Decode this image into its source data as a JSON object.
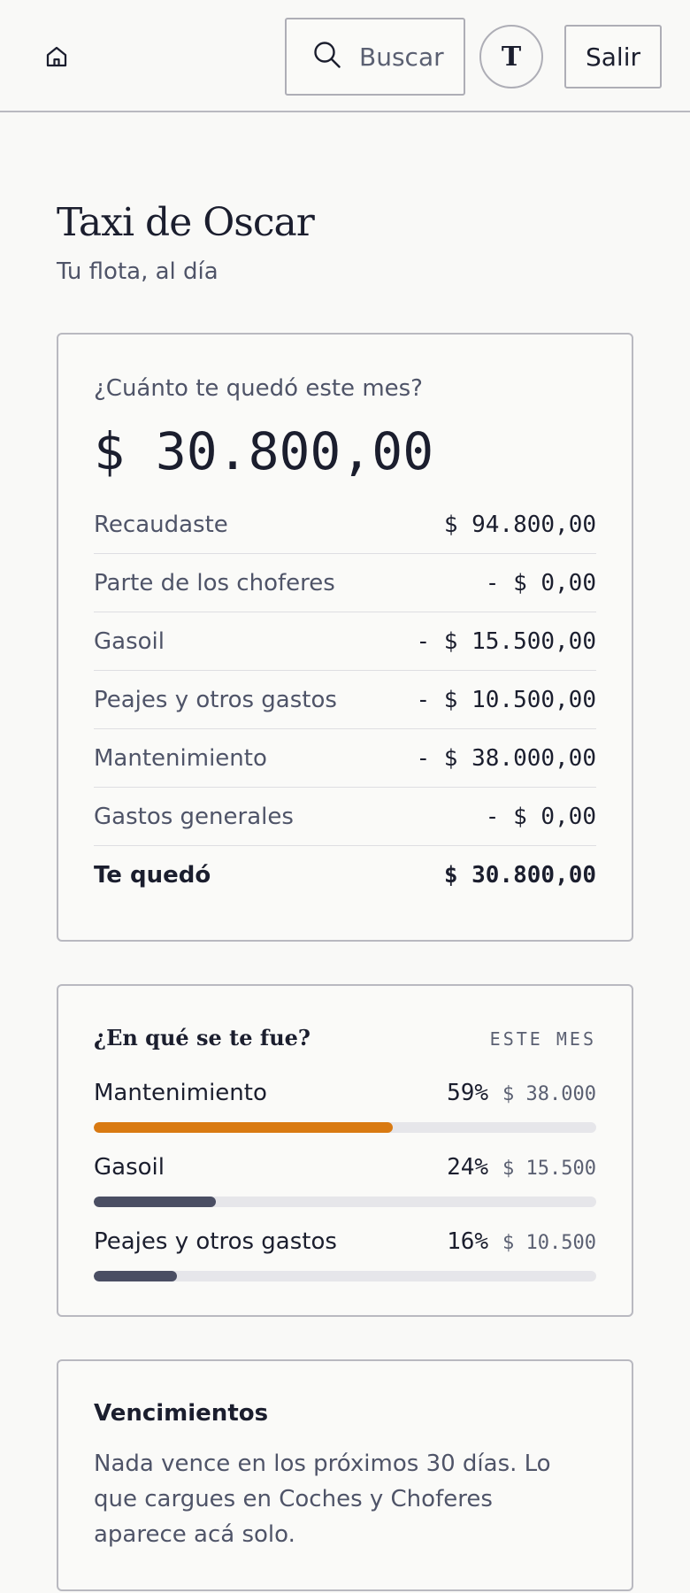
{
  "header": {
    "search_placeholder": "Buscar",
    "avatar_initial": "T",
    "logout_label": "Salir"
  },
  "page": {
    "title": "Taxi de Oscar",
    "subtitle": "Tu flota, al día"
  },
  "summary": {
    "question": "¿Cuánto te quedó este mes?",
    "total": "$ 30.800,00",
    "rows": [
      {
        "label": "Recaudaste",
        "amount": "$ 94.800,00"
      },
      {
        "label": "Parte de los choferes",
        "amount": "- $ 0,00"
      },
      {
        "label": "Gasoil",
        "amount": "- $ 15.500,00"
      },
      {
        "label": "Peajes y otros gastos",
        "amount": "- $ 10.500,00"
      },
      {
        "label": "Mantenimiento",
        "amount": "- $ 38.000,00"
      },
      {
        "label": "Gastos generales",
        "amount": "- $ 0,00"
      },
      {
        "label": "Te quedó",
        "amount": "$ 30.800,00"
      }
    ]
  },
  "spending": {
    "title": "¿En qué se te fue?",
    "period": "ESTE MES",
    "items": [
      {
        "name": "Mantenimiento",
        "percent": "59%",
        "amount": "$ 38.000",
        "fraction": 0.595,
        "color": "#d97a12"
      },
      {
        "name": "Gasoil",
        "percent": "24%",
        "amount": "$ 15.500",
        "fraction": 0.243,
        "color": "#4a4e63"
      },
      {
        "name": "Peajes y otros gastos",
        "percent": "16%",
        "amount": "$ 10.500",
        "fraction": 0.165,
        "color": "#4a4e63"
      }
    ]
  },
  "due": {
    "title": "Vencimientos",
    "text": "Nada vence en los próximos 30 días. Lo que cargues en Coches y Choferes aparece acá solo."
  }
}
